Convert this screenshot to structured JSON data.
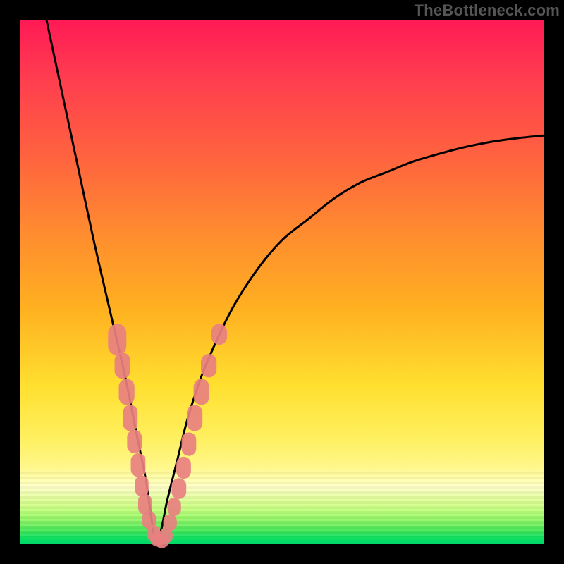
{
  "watermark": "TheBottleneck.com",
  "colors": {
    "frame": "#000000",
    "curve": "#000000",
    "marker": "#e88080",
    "gradient_top": "#ff1a55",
    "gradient_bottom": "#00d868"
  },
  "chart_data": {
    "type": "line",
    "title": "",
    "xlabel": "",
    "ylabel": "",
    "xlim": [
      0,
      100
    ],
    "ylim": [
      0,
      100
    ],
    "note": "Axes are not labeled in the source image; values are normalized 0–100. Curve is a V-shaped bottleneck curve with minimum near x≈26, y≈0. Left branch starts near (5,100), right branch exits near (100,78).",
    "series": [
      {
        "name": "bottleneck-curve",
        "x": [
          5,
          8,
          11,
          14,
          17,
          20,
          22,
          24,
          25,
          26,
          27,
          28,
          30,
          32,
          35,
          40,
          45,
          50,
          55,
          60,
          65,
          70,
          75,
          80,
          85,
          90,
          95,
          100
        ],
        "y": [
          100,
          86,
          72,
          58,
          45,
          32,
          22,
          12,
          5,
          0,
          3,
          8,
          16,
          24,
          33,
          44,
          52,
          58,
          62,
          66,
          69,
          71,
          73,
          74.5,
          75.8,
          76.8,
          77.5,
          78
        ]
      }
    ],
    "markers": {
      "name": "highlighted-points",
      "note": "Salmon lozenge markers clustered along both branches near the bottom of the V.",
      "points": [
        {
          "x": 18.5,
          "y": 39,
          "w": 3.5,
          "h": 6
        },
        {
          "x": 19.5,
          "y": 34,
          "w": 3,
          "h": 5
        },
        {
          "x": 20.3,
          "y": 29,
          "w": 3,
          "h": 5
        },
        {
          "x": 21,
          "y": 24,
          "w": 2.8,
          "h": 5
        },
        {
          "x": 21.8,
          "y": 19.5,
          "w": 2.8,
          "h": 4.5
        },
        {
          "x": 22.5,
          "y": 15,
          "w": 2.8,
          "h": 4.5
        },
        {
          "x": 23.2,
          "y": 11,
          "w": 2.6,
          "h": 4
        },
        {
          "x": 23.8,
          "y": 7.5,
          "w": 2.6,
          "h": 4
        },
        {
          "x": 24.6,
          "y": 4.5,
          "w": 2.6,
          "h": 3.5
        },
        {
          "x": 25.4,
          "y": 2,
          "w": 2.6,
          "h": 3
        },
        {
          "x": 26.2,
          "y": 0.8,
          "w": 2.8,
          "h": 2.8
        },
        {
          "x": 27,
          "y": 0.5,
          "w": 2.8,
          "h": 2.8
        },
        {
          "x": 27.8,
          "y": 1.5,
          "w": 2.6,
          "h": 3
        },
        {
          "x": 28.6,
          "y": 4,
          "w": 2.6,
          "h": 3.2
        },
        {
          "x": 29.4,
          "y": 7,
          "w": 2.6,
          "h": 3.5
        },
        {
          "x": 30.3,
          "y": 10.5,
          "w": 2.8,
          "h": 4
        },
        {
          "x": 31.2,
          "y": 14.5,
          "w": 2.8,
          "h": 4.2
        },
        {
          "x": 32.2,
          "y": 19,
          "w": 2.8,
          "h": 4.5
        },
        {
          "x": 33.3,
          "y": 24,
          "w": 3,
          "h": 5
        },
        {
          "x": 34.6,
          "y": 29,
          "w": 3,
          "h": 5
        },
        {
          "x": 36,
          "y": 34,
          "w": 3,
          "h": 4.5
        },
        {
          "x": 38,
          "y": 40,
          "w": 3,
          "h": 4
        }
      ]
    }
  }
}
